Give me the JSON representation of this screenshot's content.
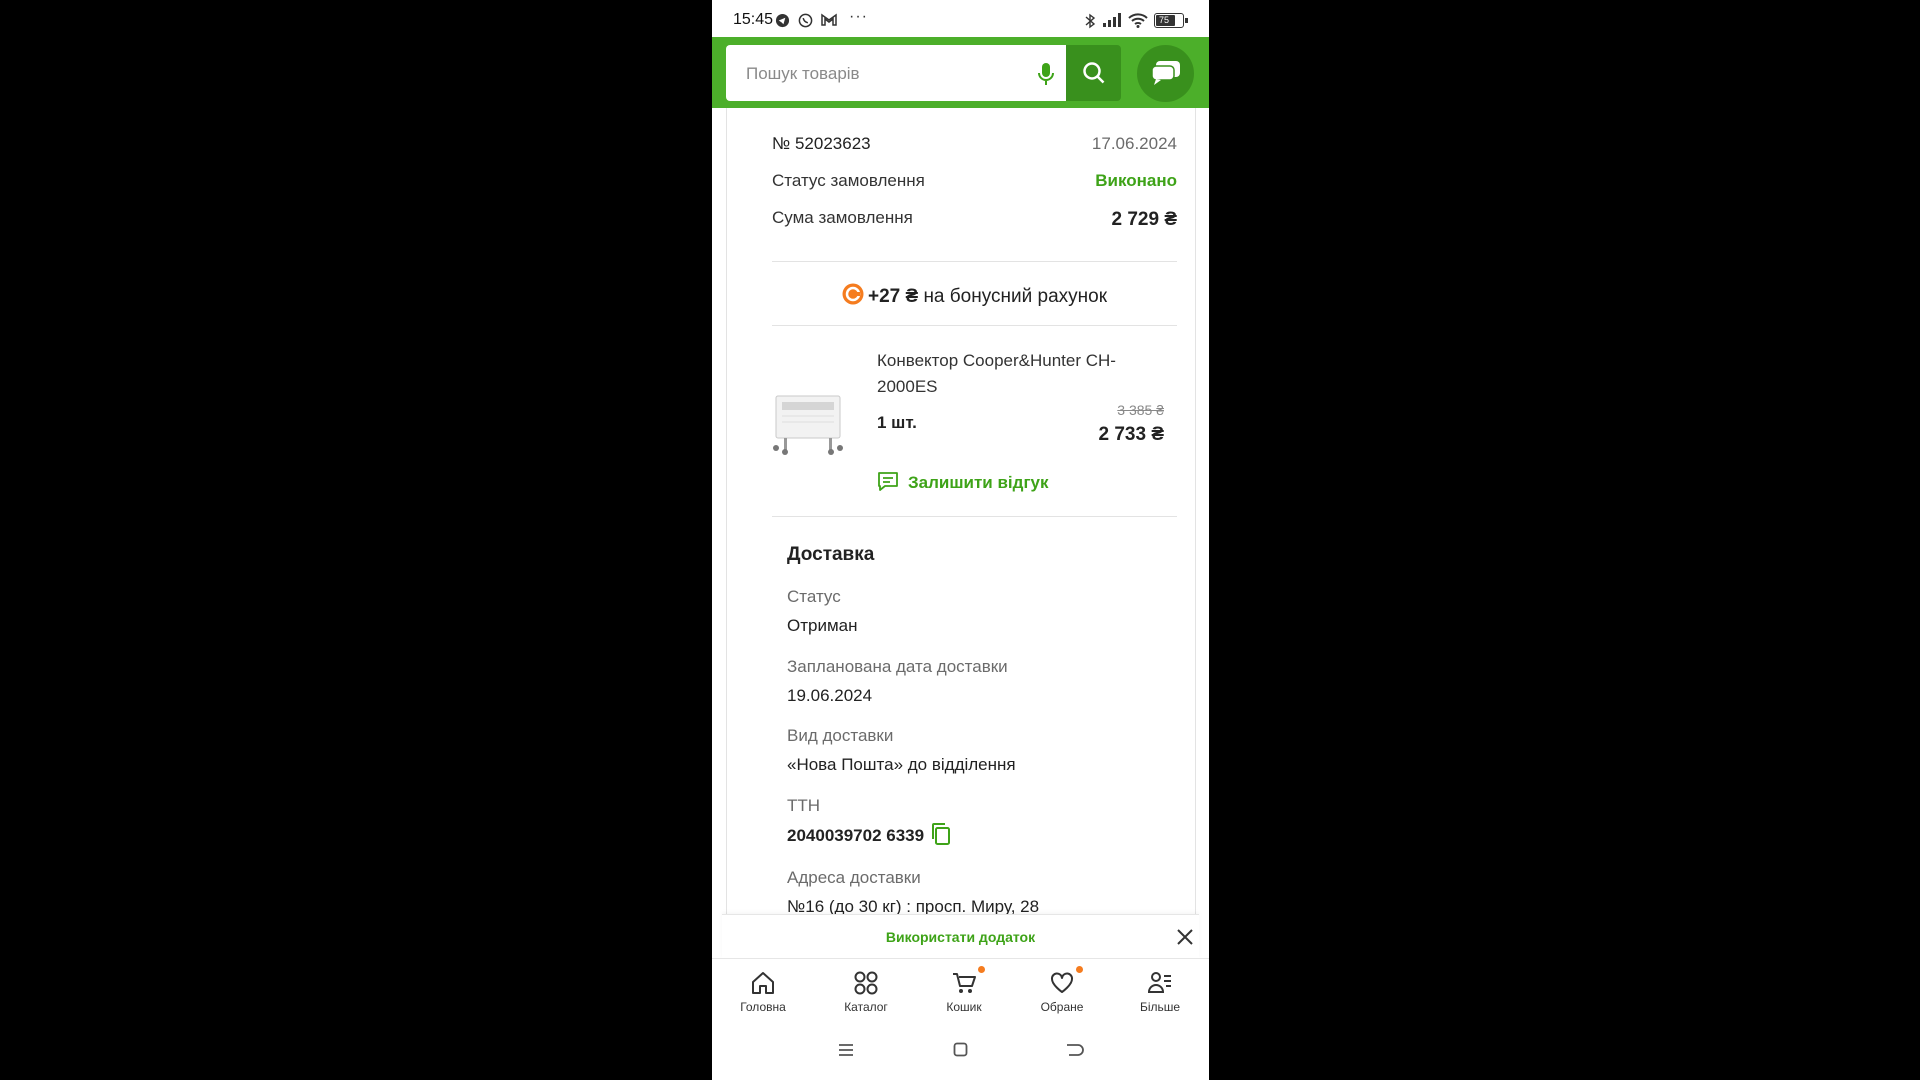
{
  "status_bar": {
    "time": "15:45",
    "battery": "75"
  },
  "search": {
    "placeholder": "Пошук товарів"
  },
  "order": {
    "number": "№ 52023623",
    "date": "17.06.2024",
    "status_label": "Статус замовлення",
    "status_value": "Виконано",
    "sum_label": "Сума замовлення",
    "sum_value": "2 729 ₴",
    "bonus_amount": "+27 ₴",
    "bonus_text": "на бонусний рахунок"
  },
  "product": {
    "name": "Конвектор Cooper&Hunter CH-2000ES",
    "quantity": "1 шт.",
    "old_price": "3 385 ₴",
    "price": "2 733 ₴",
    "review_label": "Залишити відгук"
  },
  "delivery": {
    "heading": "Доставка",
    "status_label": "Статус",
    "status_value": "Отриман",
    "date_label": "Запланована дата доставки",
    "date_value": "19.06.2024",
    "type_label": "Вид доставки",
    "type_value": "«Нова Пошта» до відділення",
    "ttn_label": "ТТН",
    "ttn_value": "2040039702 6339",
    "address_label": "Адреса доставки",
    "address_value": "№16 (до 30 кг) : просп. Миру, 28"
  },
  "banner": {
    "use_app": "Використати додаток"
  },
  "tabs": [
    {
      "label": "Головна"
    },
    {
      "label": "Каталог"
    },
    {
      "label": "Кошик"
    },
    {
      "label": "Обране"
    },
    {
      "label": "Більше"
    }
  ],
  "colors": {
    "brand_green": "#4caf2a",
    "dark_green": "#39901d",
    "accent_orange": "#f57c1f"
  }
}
